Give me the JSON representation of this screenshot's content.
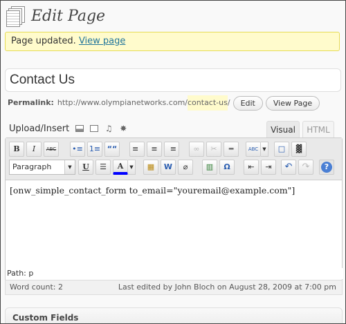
{
  "page": {
    "title": "Edit Page"
  },
  "notice": {
    "message": "Page updated.",
    "link": "View page"
  },
  "post": {
    "title": "Contact Us"
  },
  "permalink": {
    "label": "Permalink:",
    "base": "http://www.olympianetworks.com/",
    "slug": "contact-us",
    "trail": "/",
    "edit_button": "Edit",
    "view_button": "View Page"
  },
  "upload": {
    "label": "Upload/Insert",
    "icons": [
      "add-image-icon",
      "add-video-icon",
      "add-audio-icon",
      "add-media-icon"
    ]
  },
  "editor_tabs": {
    "visual": "Visual",
    "html": "HTML"
  },
  "toolbar": {
    "row1": [
      "bold",
      "italic",
      "strikethrough",
      "bullet-list",
      "numbered-list",
      "blockquote",
      "align-left",
      "align-center",
      "align-right",
      "insert-link",
      "unlink",
      "insert-more",
      "spellcheck",
      "fullscreen",
      "kitchen-sink"
    ],
    "row2": [
      "format-select",
      "underline",
      "justify",
      "text-color",
      "paste-as-text",
      "paste-from-word",
      "remove-format",
      "insert-media",
      "special-character",
      "outdent",
      "indent",
      "undo",
      "redo",
      "help"
    ],
    "format_value": "Paragraph",
    "glyphs": {
      "bold": "B",
      "italic": "I",
      "strike": "ABC",
      "spell": "ABC",
      "ul": "•≡",
      "ol": "1≡",
      "quote": "““",
      "align": "≡",
      "link": "∞",
      "unlink": "✂",
      "more": "═",
      "full": "□",
      "sink": "▓",
      "underline": "U",
      "justify": "☰",
      "color": "A",
      "paste": "▦",
      "word": "W",
      "eraser": "⌀",
      "film": "▥",
      "omega": "Ω",
      "outdent": "⇤",
      "indent": "⇥",
      "undo": "↶",
      "redo": "↷",
      "help": "?"
    }
  },
  "editor": {
    "content": "[onw_simple_contact_form to_email=\"youremail@example.com\"]",
    "path": "Path: p"
  },
  "status": {
    "word_count": "Word count: 2",
    "last_edited": "Last edited by John Bloch on August 28, 2009 at 7:00 pm"
  },
  "custom_fields": {
    "title": "Custom Fields"
  },
  "colors": {
    "notice_bg": "#fffbcc",
    "link": "#21759b",
    "text_color_bar": "#0000ff"
  }
}
